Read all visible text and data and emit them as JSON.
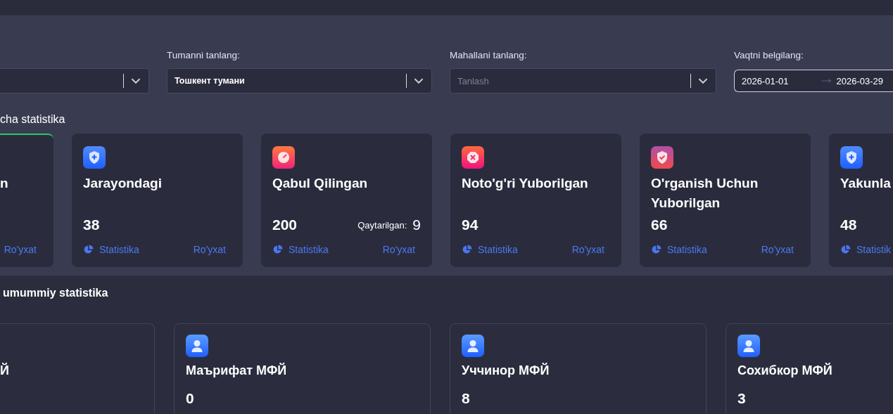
{
  "filters": [
    {
      "kind": "select"
    },
    {
      "kind": "select",
      "label": "Tumanni tanlang:",
      "value": "Тошкент тумани"
    },
    {
      "kind": "select",
      "label": "Mahallani tanlang:",
      "placeholder": "Tanlash"
    },
    {
      "kind": "date_range",
      "label": "Vaqtni belgilang:",
      "start": "2026-01-01",
      "end": "2026-03-29"
    }
  ],
  "status_section": {
    "heading": "cha statistika",
    "cards": [
      {
        "kind": "partial",
        "selected": true,
        "title": "n",
        "list_link": "Ro'yxat"
      },
      {
        "kind": "progress",
        "selected": false,
        "title": "Jarayondagi",
        "value": "38",
        "stats_link": "Statistika",
        "list_link": "Ro'yxat"
      },
      {
        "kind": "accepted",
        "selected": false,
        "title": "Qabul Qilingan",
        "value": "200",
        "returned_label": "Qaytarilgan:",
        "returned_value": "9",
        "stats_link": "Statistika",
        "list_link": "Ro'yxat"
      },
      {
        "kind": "rejected",
        "selected": false,
        "title": "Noto'g'ri Yuborilgan",
        "value": "94",
        "stats_link": "Statistika",
        "list_link": "Ro'yxat"
      },
      {
        "kind": "review",
        "selected": false,
        "title": "O'rganish Uchun Yuborilgan",
        "value": "66",
        "stats_link": "Statistika",
        "list_link": "Ro'yxat"
      },
      {
        "kind": "finished",
        "selected": false,
        "title": "Yakunla",
        "value": "48",
        "stats_link": "Statistik"
      }
    ]
  },
  "mahalla_section": {
    "heading": "umummiy statistika",
    "cards": [
      {
        "kind": "partial",
        "title": "Й"
      },
      {
        "kind": "full",
        "title": "Маърифат МФЙ",
        "value": "0"
      },
      {
        "kind": "full",
        "title": "Уччинор МФЙ",
        "value": "8"
      },
      {
        "kind": "full",
        "title": "Сохибкор МФЙ",
        "value": "3"
      }
    ]
  }
}
